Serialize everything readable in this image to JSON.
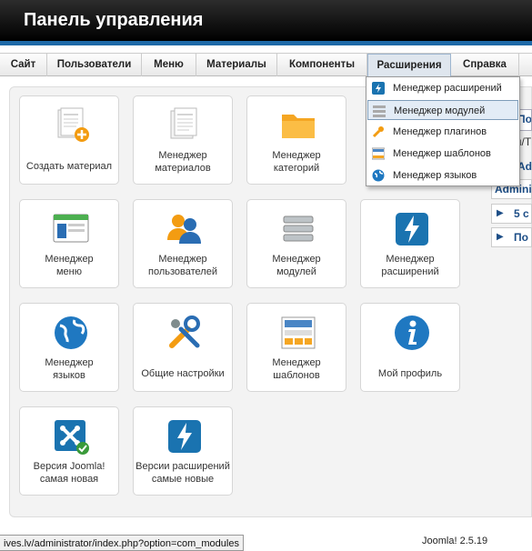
{
  "header": {
    "title": "Панель управления"
  },
  "menu": {
    "items": [
      {
        "label": "Сайт"
      },
      {
        "label": "Пользователи"
      },
      {
        "label": "Меню"
      },
      {
        "label": "Материалы"
      },
      {
        "label": "Компоненты"
      },
      {
        "label": "Расширения"
      },
      {
        "label": "Справка"
      }
    ]
  },
  "dropdown": {
    "items": [
      {
        "label": "Менеджер расширений",
        "icon": "extension-icon"
      },
      {
        "label": "Менеджер модулей",
        "icon": "modules-icon"
      },
      {
        "label": "Менеджер плагинов",
        "icon": "plugin-icon"
      },
      {
        "label": "Менеджер шаблонов",
        "icon": "template-icon"
      },
      {
        "label": "Менеджер языков",
        "icon": "language-icon"
      }
    ]
  },
  "tiles": [
    {
      "line1": "Создать материал",
      "line2": "",
      "icon": "new-article-icon"
    },
    {
      "line1": "Менеджер",
      "line2": "материалов",
      "icon": "articles-icon"
    },
    {
      "line1": "Менеджер",
      "line2": "категорий",
      "icon": "folder-icon"
    },
    {
      "line1": "Менеджер",
      "line2": "меню",
      "icon": "menu-icon"
    },
    {
      "line1": "Менеджер",
      "line2": "пользователей",
      "icon": "users-icon"
    },
    {
      "line1": "Менеджер",
      "line2": "модулей",
      "icon": "modules-icon"
    },
    {
      "line1": "Менеджер",
      "line2": "расширений",
      "icon": "extension-icon"
    },
    {
      "line1": "Менеджер",
      "line2": "языков",
      "icon": "globe-icon"
    },
    {
      "line1": "Общие настройки",
      "line2": "",
      "icon": "tools-icon"
    },
    {
      "line1": "Менеджер",
      "line2": "шаблонов",
      "icon": "template-icon"
    },
    {
      "line1": "Мой профиль",
      "line2": "",
      "icon": "info-icon"
    },
    {
      "line1": "Версия Joomla!",
      "line2": "самая новая",
      "icon": "joomla-icon"
    },
    {
      "line1": "Версии расширений",
      "line2": "самые новые",
      "icon": "extension-icon"
    }
  ],
  "side": {
    "items": [
      {
        "text": "По"
      },
      {
        "text": "я/Т"
      },
      {
        "text": "Admini"
      },
      {
        "text": "Admini"
      },
      {
        "text": "5 с"
      },
      {
        "text": "По"
      }
    ]
  },
  "status": {
    "url": "ives.lv/administrator/index.php?option=com_modules",
    "version": "Joomla! 2.5.19"
  },
  "colors": {
    "accent": "#1e6aa8",
    "menu_bg": "#e8e8e8",
    "panel_bg": "#f3f3f3"
  }
}
